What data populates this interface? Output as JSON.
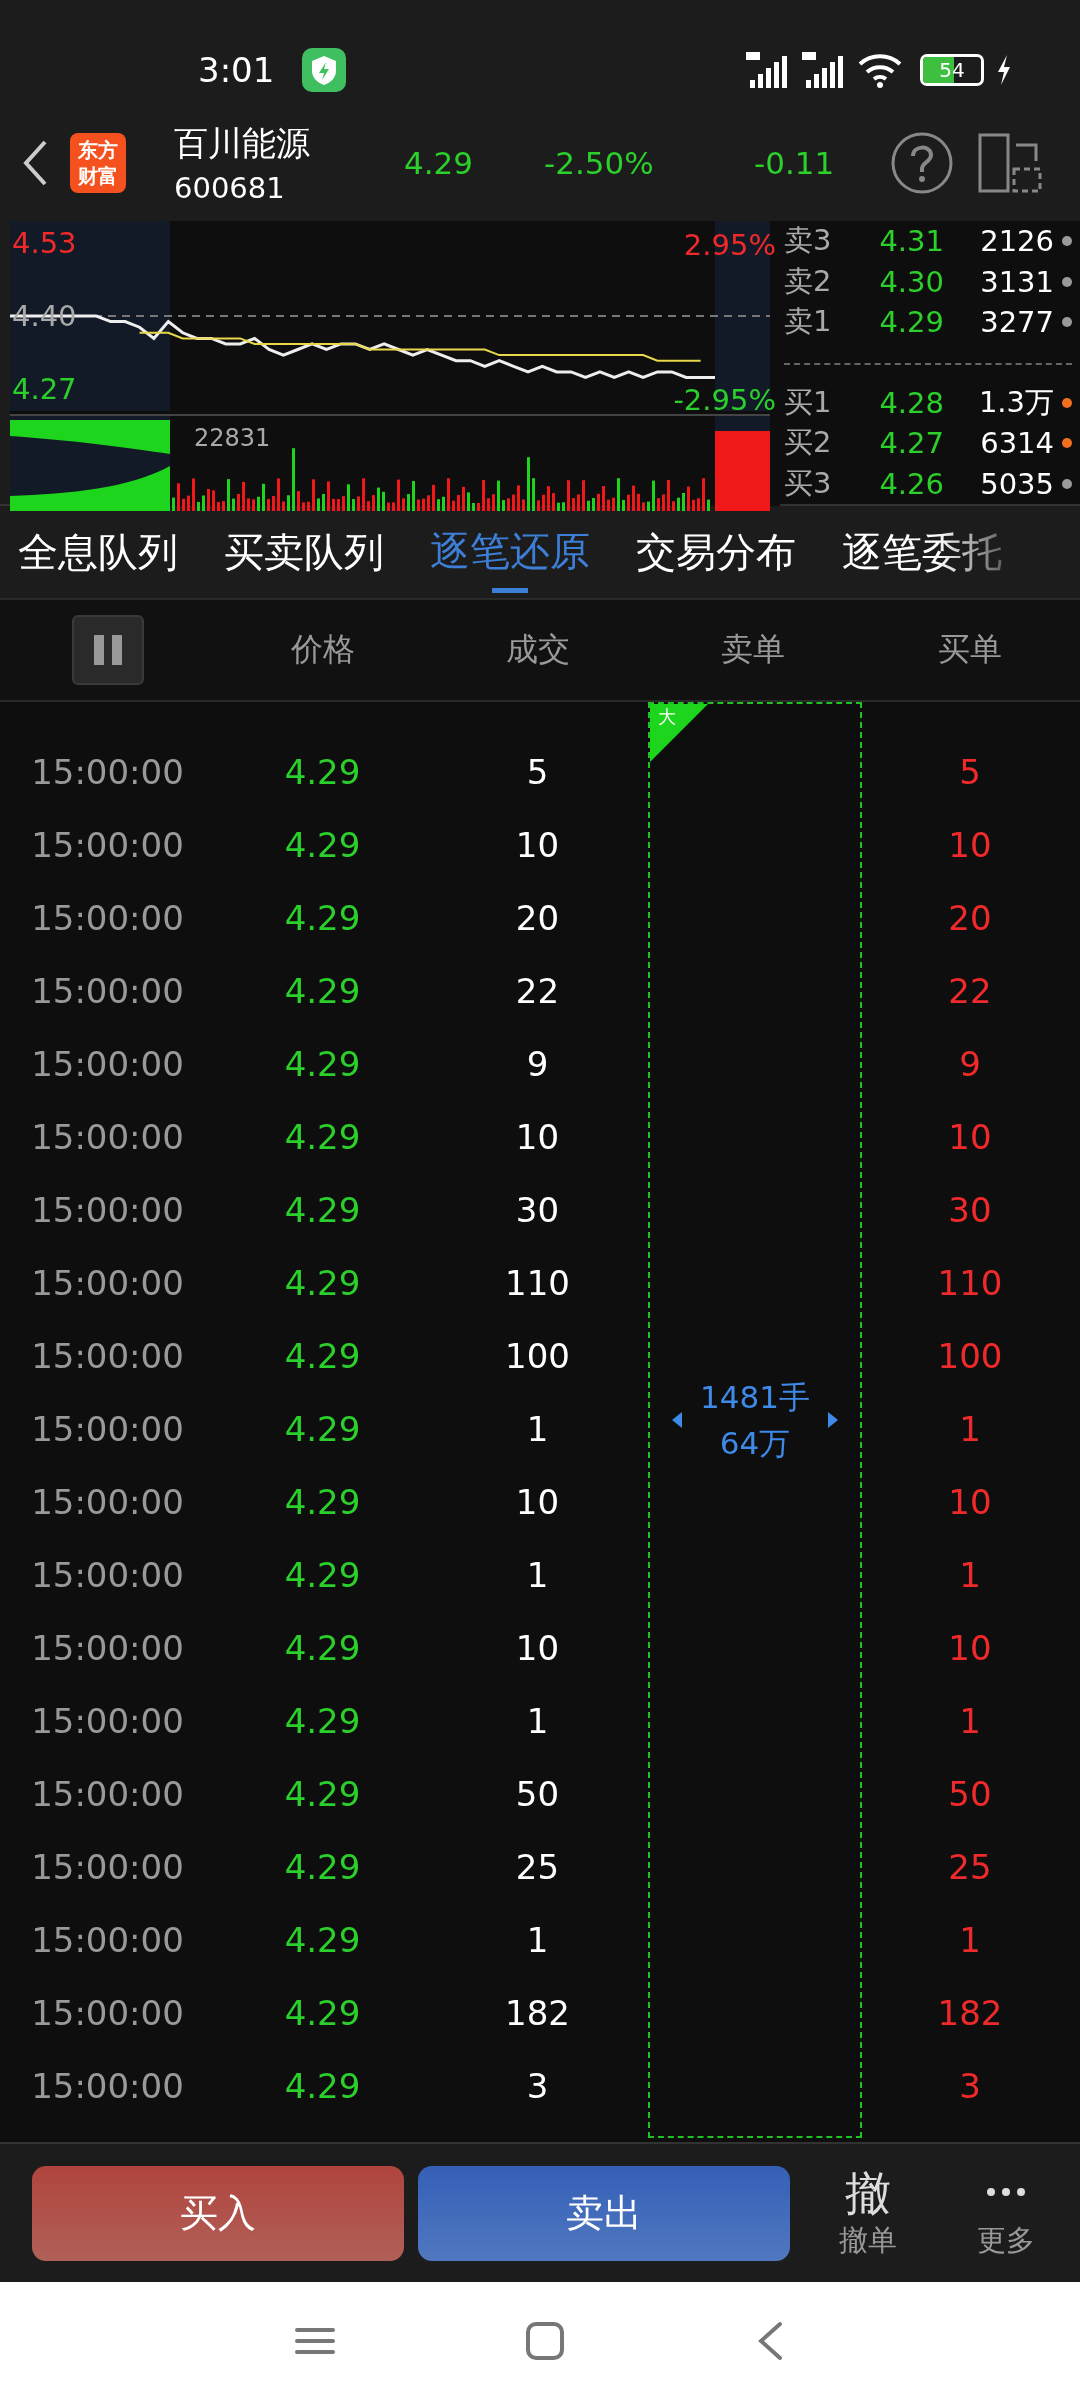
{
  "status_bar": {
    "time": "3:01",
    "battery": "54"
  },
  "header": {
    "name": "百川能源",
    "code": "600681",
    "price": "4.29",
    "change_pct": "-2.50%",
    "change": "-0.11",
    "logo": "东方财富"
  },
  "chart": {
    "high_pct": "2.95%",
    "low_pct": "-2.95%",
    "volume": "22831",
    "chart_data": {
      "type": "line",
      "ylim": [
        4.06,
        4.57
      ],
      "yticks": [
        {
          "value": 4.53,
          "label": "4.53"
        },
        {
          "value": 4.4,
          "label": "4.40"
        },
        {
          "value": 4.27,
          "label": "4.27"
        }
      ],
      "series": [
        {
          "color": "#eeeeee",
          "values": [
            4.4,
            4.4,
            4.4,
            4.4,
            4.4,
            4.4,
            4.4,
            4.39,
            4.39,
            4.38,
            4.36,
            4.39,
            4.37,
            4.36,
            4.36,
            4.35,
            4.35,
            4.36,
            4.34,
            4.33,
            4.34,
            4.35,
            4.34,
            4.35,
            4.35,
            4.34,
            4.35,
            4.34,
            4.33,
            4.34,
            4.33,
            4.32,
            4.32,
            4.31,
            4.32,
            4.31,
            4.3,
            4.31,
            4.3,
            4.3,
            4.29,
            4.3,
            4.29,
            4.3,
            4.29,
            4.3,
            4.3,
            4.29,
            4.29,
            4.29
          ]
        },
        {
          "color": "#e8d84a",
          "values": [
            null,
            null,
            null,
            null,
            null,
            null,
            null,
            null,
            null,
            4.37,
            4.37,
            4.37,
            4.36,
            4.36,
            4.36,
            4.36,
            4.36,
            4.35,
            4.35,
            4.35,
            4.35,
            4.35,
            4.35,
            4.35,
            4.35,
            4.34,
            4.34,
            4.34,
            4.34,
            4.34,
            4.34,
            4.34,
            4.34,
            4.34,
            4.33,
            4.33,
            4.33,
            4.33,
            4.33,
            4.33,
            4.33,
            4.33,
            4.33,
            4.33,
            4.33,
            4.32,
            4.32,
            4.32,
            4.32,
            null
          ]
        }
      ]
    }
  },
  "order_book": [
    {
      "label": "卖3",
      "price": "4.31",
      "volume": "2126",
      "color": "#9a9a9a"
    },
    {
      "label": "卖2",
      "price": "4.30",
      "volume": "3131",
      "color": "#9a9a9a"
    },
    {
      "label": "卖1",
      "price": "4.29",
      "volume": "3277",
      "color": "#9a9a9a"
    },
    {
      "label": "买1",
      "price": "4.28",
      "volume": "1.3万",
      "color": "#f07020"
    },
    {
      "label": "买2",
      "price": "4.27",
      "volume": "6314",
      "color": "#f07020"
    },
    {
      "label": "买3",
      "price": "4.26",
      "volume": "5035",
      "color": "#9a9a9a"
    }
  ],
  "tabs": [
    {
      "label": "全息队列",
      "selected": false
    },
    {
      "label": "买卖队列",
      "selected": false
    },
    {
      "label": "逐笔还原",
      "selected": true
    },
    {
      "label": "交易分布",
      "selected": false
    },
    {
      "label": "逐笔委托",
      "selected": false
    }
  ],
  "table": {
    "columns": [
      "价格",
      "成交",
      "卖单",
      "买单"
    ],
    "sell_block": {
      "tag": "大",
      "lots": "1481手",
      "amount": "64万"
    },
    "rows": [
      {
        "time": "15:00:00",
        "price": "4.29",
        "volume": "5",
        "buy": "5"
      },
      {
        "time": "15:00:00",
        "price": "4.29",
        "volume": "10",
        "buy": "10"
      },
      {
        "time": "15:00:00",
        "price": "4.29",
        "volume": "20",
        "buy": "20"
      },
      {
        "time": "15:00:00",
        "price": "4.29",
        "volume": "22",
        "buy": "22"
      },
      {
        "time": "15:00:00",
        "price": "4.29",
        "volume": "9",
        "buy": "9"
      },
      {
        "time": "15:00:00",
        "price": "4.29",
        "volume": "10",
        "buy": "10"
      },
      {
        "time": "15:00:00",
        "price": "4.29",
        "volume": "30",
        "buy": "30"
      },
      {
        "time": "15:00:00",
        "price": "4.29",
        "volume": "110",
        "buy": "110"
      },
      {
        "time": "15:00:00",
        "price": "4.29",
        "volume": "100",
        "buy": "100"
      },
      {
        "time": "15:00:00",
        "price": "4.29",
        "volume": "1",
        "buy": "1"
      },
      {
        "time": "15:00:00",
        "price": "4.29",
        "volume": "10",
        "buy": "10"
      },
      {
        "time": "15:00:00",
        "price": "4.29",
        "volume": "1",
        "buy": "1"
      },
      {
        "time": "15:00:00",
        "price": "4.29",
        "volume": "10",
        "buy": "10"
      },
      {
        "time": "15:00:00",
        "price": "4.29",
        "volume": "1",
        "buy": "1"
      },
      {
        "time": "15:00:00",
        "price": "4.29",
        "volume": "50",
        "buy": "50"
      },
      {
        "time": "15:00:00",
        "price": "4.29",
        "volume": "25",
        "buy": "25"
      },
      {
        "time": "15:00:00",
        "price": "4.29",
        "volume": "1",
        "buy": "1"
      },
      {
        "time": "15:00:00",
        "price": "4.29",
        "volume": "182",
        "buy": "182"
      },
      {
        "time": "15:00:00",
        "price": "4.29",
        "volume": "3",
        "buy": "3"
      }
    ]
  },
  "bottom_bar": {
    "buy": "买入",
    "sell": "卖出",
    "cancel_icon": "撤",
    "cancel": "撤单",
    "more": "更多"
  }
}
